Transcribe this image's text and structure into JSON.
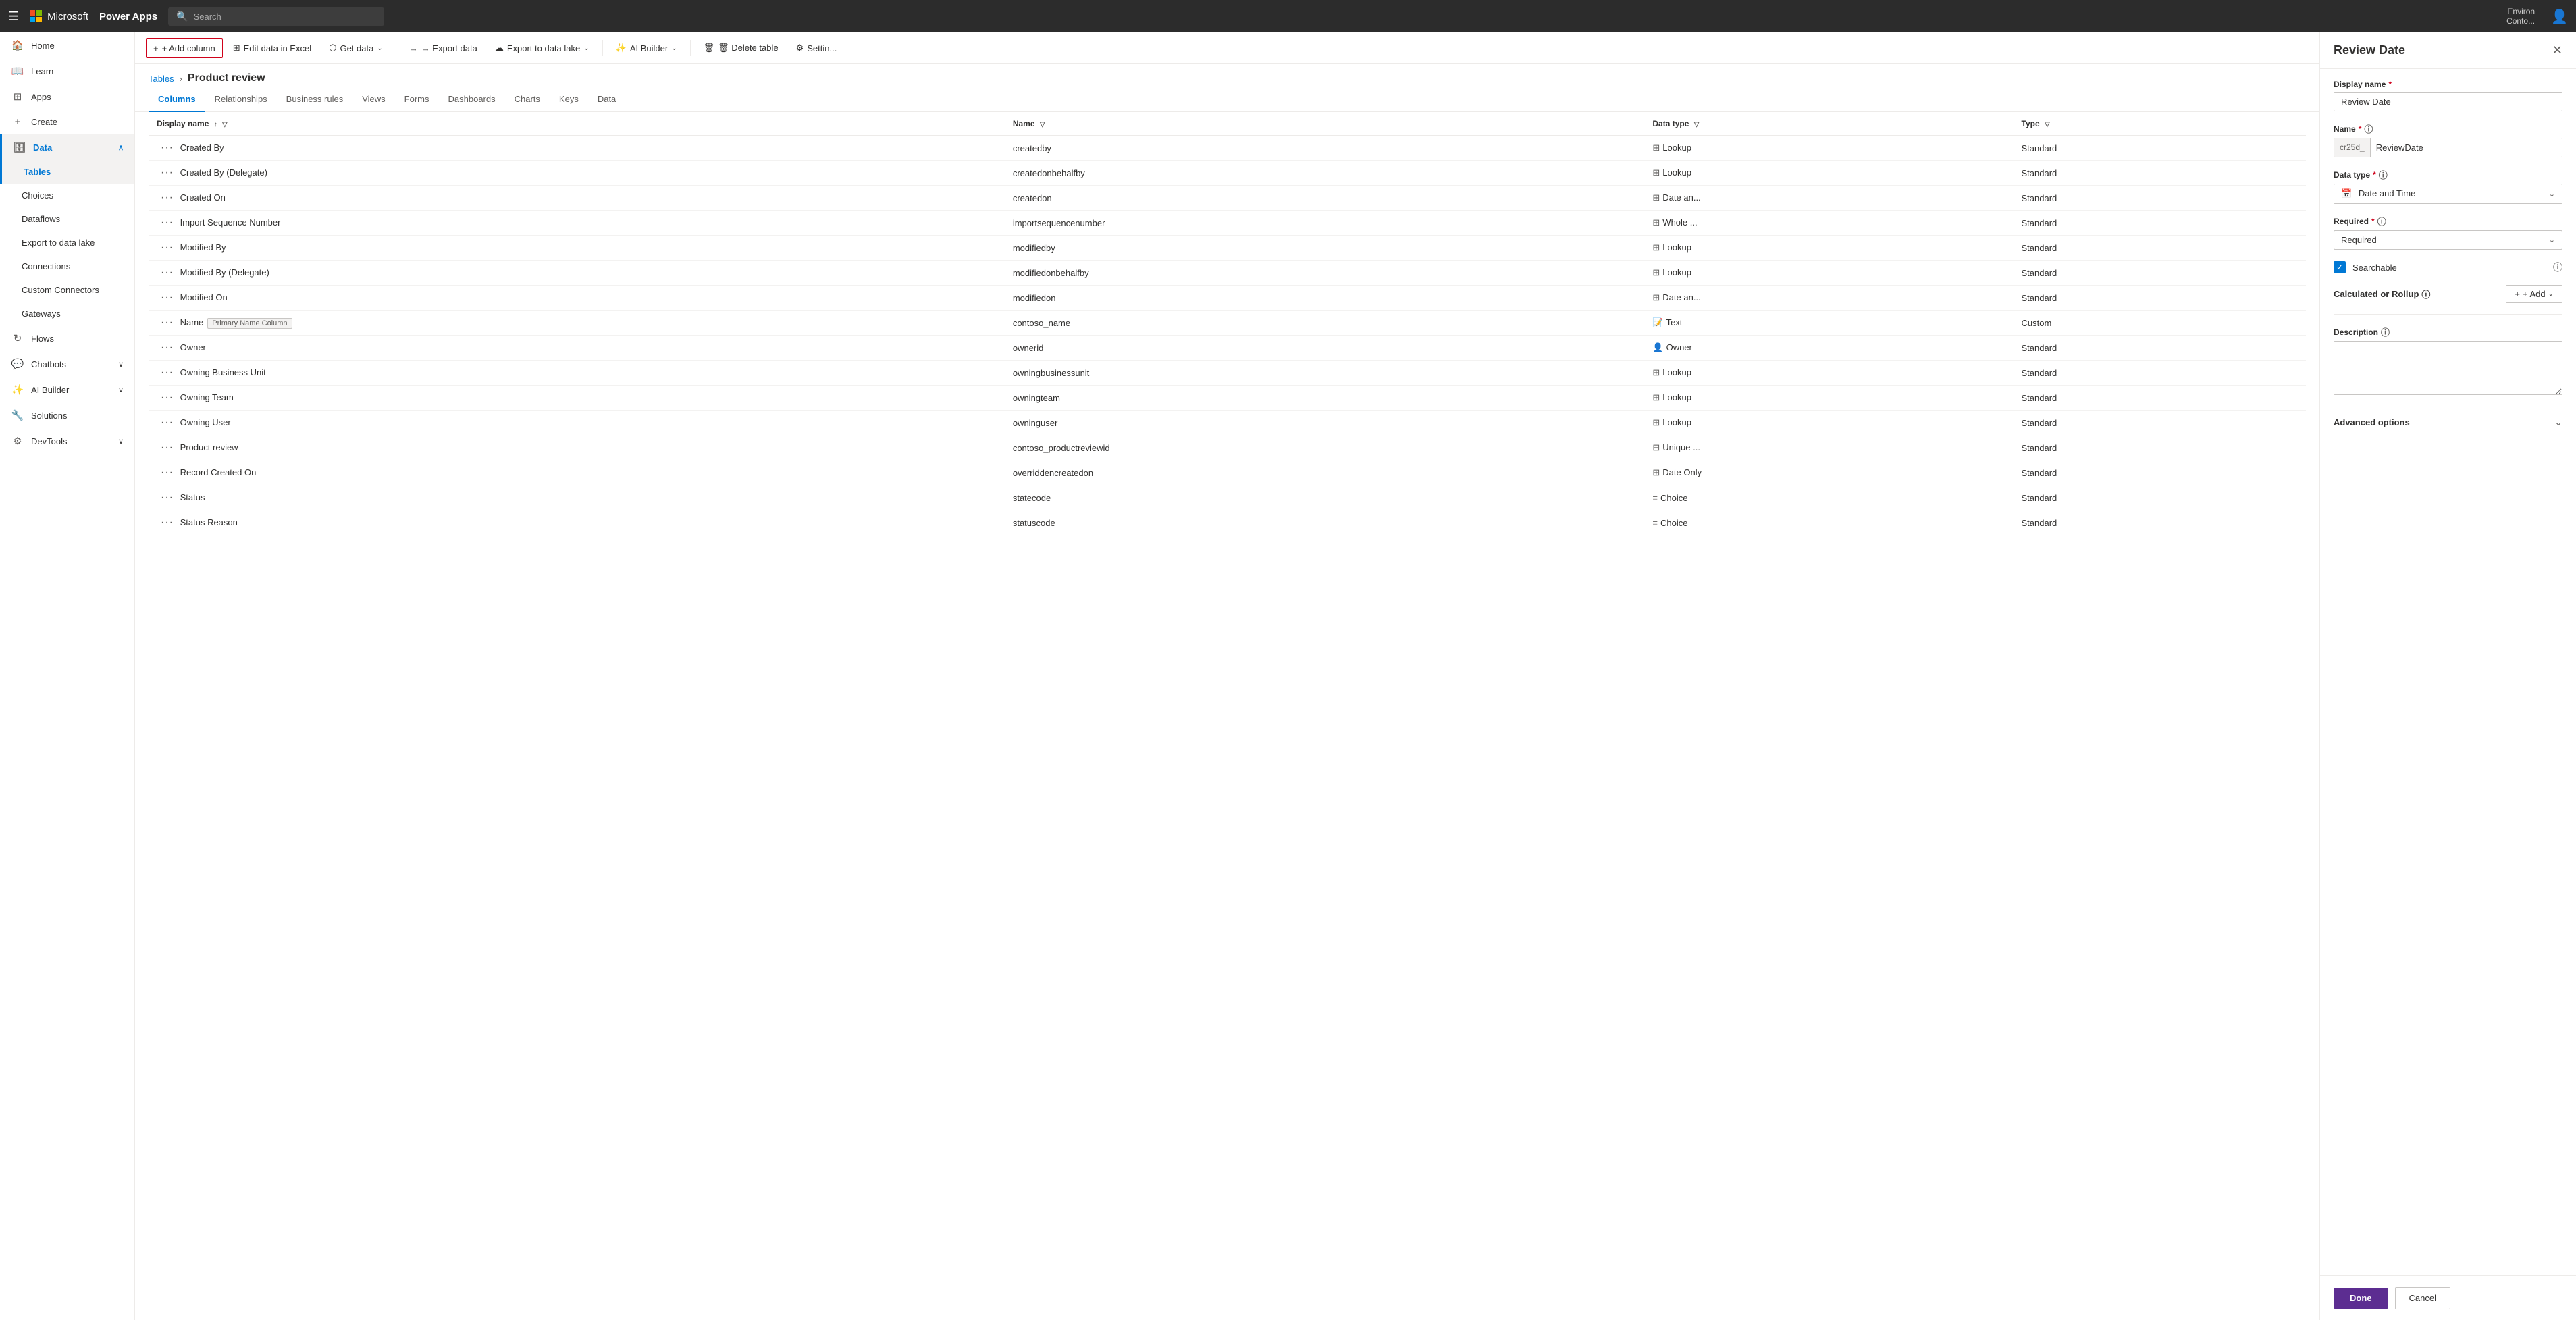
{
  "topNav": {
    "appName": "Power Apps",
    "searchPlaceholder": "Search",
    "env": "Environ",
    "user": "Conto..."
  },
  "sidebar": {
    "hamburgerIcon": "☰",
    "items": [
      {
        "id": "home",
        "label": "Home",
        "icon": "🏠",
        "active": false
      },
      {
        "id": "learn",
        "label": "Learn",
        "icon": "📖",
        "active": false
      },
      {
        "id": "apps",
        "label": "Apps",
        "icon": "⊞",
        "active": false
      },
      {
        "id": "create",
        "label": "Create",
        "icon": "+",
        "active": false
      },
      {
        "id": "data",
        "label": "Data",
        "icon": "🗄",
        "active": true,
        "expandable": true,
        "expanded": true
      },
      {
        "id": "tables",
        "label": "Tables",
        "sub": true,
        "active": true
      },
      {
        "id": "choices",
        "label": "Choices",
        "sub": true,
        "active": false
      },
      {
        "id": "dataflows",
        "label": "Dataflows",
        "sub": true,
        "active": false
      },
      {
        "id": "export-data-lake",
        "label": "Export to data lake",
        "sub": true,
        "active": false
      },
      {
        "id": "connections",
        "label": "Connections",
        "sub": true,
        "active": false
      },
      {
        "id": "custom-connectors",
        "label": "Custom Connectors",
        "sub": true,
        "active": false
      },
      {
        "id": "gateways",
        "label": "Gateways",
        "sub": true,
        "active": false
      },
      {
        "id": "flows",
        "label": "Flows",
        "icon": "↻",
        "active": false
      },
      {
        "id": "chatbots",
        "label": "Chatbots",
        "icon": "💬",
        "active": false,
        "expandable": true
      },
      {
        "id": "ai-builder",
        "label": "AI Builder",
        "icon": "✨",
        "active": false,
        "expandable": true
      },
      {
        "id": "solutions",
        "label": "Solutions",
        "icon": "🔧",
        "active": false
      },
      {
        "id": "devtools",
        "label": "DevTools",
        "icon": "⚙",
        "active": false,
        "expandable": true
      }
    ]
  },
  "toolbar": {
    "addColumnLabel": "+ Add column",
    "editExcelLabel": "Edit data in Excel",
    "getDataLabel": "Get data",
    "exportDataLabel": "→ Export data",
    "exportDataLakeLabel": "Export to data lake",
    "aiBuilderLabel": "AI Builder",
    "deleteTableLabel": "🗑 Delete table",
    "settingsLabel": "Settin..."
  },
  "breadcrumb": {
    "parent": "Tables",
    "current": "Product review"
  },
  "tabs": [
    {
      "id": "columns",
      "label": "Columns",
      "active": true
    },
    {
      "id": "relationships",
      "label": "Relationships",
      "active": false
    },
    {
      "id": "business-rules",
      "label": "Business rules",
      "active": false
    },
    {
      "id": "views",
      "label": "Views",
      "active": false
    },
    {
      "id": "forms",
      "label": "Forms",
      "active": false
    },
    {
      "id": "dashboards",
      "label": "Dashboards",
      "active": false
    },
    {
      "id": "charts",
      "label": "Charts",
      "active": false
    },
    {
      "id": "keys",
      "label": "Keys",
      "active": false
    },
    {
      "id": "data",
      "label": "Data",
      "active": false
    }
  ],
  "tableHeaders": [
    {
      "id": "display-name",
      "label": "Display name",
      "sortable": true,
      "sortDir": "asc"
    },
    {
      "id": "name",
      "label": "Name",
      "sortable": true
    },
    {
      "id": "data-type",
      "label": "Data type",
      "sortable": true
    },
    {
      "id": "type",
      "label": "Type",
      "sortable": true
    }
  ],
  "tableRows": [
    {
      "displayName": "Created By",
      "name": "createdby",
      "dataType": "Lookup",
      "typeIcon": "⊞",
      "type": "Standard"
    },
    {
      "displayName": "Created By (Delegate)",
      "name": "createdonbehalfby",
      "dataType": "Lookup",
      "typeIcon": "⊞",
      "type": "Standard"
    },
    {
      "displayName": "Created On",
      "name": "createdon",
      "dataType": "Date an...",
      "typeIcon": "⊞",
      "type": "Standard"
    },
    {
      "displayName": "Import Sequence Number",
      "name": "importsequencenumber",
      "dataType": "Whole ...",
      "typeIcon": "⊞",
      "type": "Standard"
    },
    {
      "displayName": "Modified By",
      "name": "modifiedby",
      "dataType": "Lookup",
      "typeIcon": "⊞",
      "type": "Standard"
    },
    {
      "displayName": "Modified By (Delegate)",
      "name": "modifiedonbehalfby",
      "dataType": "Lookup",
      "typeIcon": "⊞",
      "type": "Standard"
    },
    {
      "displayName": "Modified On",
      "name": "modifiedon",
      "dataType": "Date an...",
      "typeIcon": "⊞",
      "type": "Standard"
    },
    {
      "displayName": "Name",
      "name": "contoso_name",
      "badge": "Primary Name Column",
      "dataType": "Text",
      "typeIcon": "📝",
      "type": "Custom"
    },
    {
      "displayName": "Owner",
      "name": "ownerid",
      "dataType": "Owner",
      "typeIcon": "👤",
      "type": "Standard"
    },
    {
      "displayName": "Owning Business Unit",
      "name": "owningbusinessunit",
      "dataType": "Lookup",
      "typeIcon": "⊞",
      "type": "Standard"
    },
    {
      "displayName": "Owning Team",
      "name": "owningteam",
      "dataType": "Lookup",
      "typeIcon": "⊞",
      "type": "Standard"
    },
    {
      "displayName": "Owning User",
      "name": "owninguser",
      "dataType": "Lookup",
      "typeIcon": "⊞",
      "type": "Standard"
    },
    {
      "displayName": "Product review",
      "name": "contoso_productreviewid",
      "dataType": "Unique ...",
      "typeIcon": "⊟",
      "type": "Standard"
    },
    {
      "displayName": "Record Created On",
      "name": "overriddencreatedon",
      "dataType": "Date Only",
      "typeIcon": "⊞",
      "type": "Standard"
    },
    {
      "displayName": "Status",
      "name": "statecode",
      "dataType": "Choice",
      "typeIcon": "≡",
      "type": "Standard"
    },
    {
      "displayName": "Status Reason",
      "name": "statuscode",
      "dataType": "Choice",
      "typeIcon": "≡",
      "type": "Standard"
    }
  ],
  "panel": {
    "title": "Review Date",
    "closeIcon": "✕",
    "displayNameLabel": "Display name",
    "displayNameValue": "Review Date",
    "nameLabel": "Name",
    "namePrefix": "cr25d_",
    "nameValue": "ReviewDate",
    "dataTypeLabel": "Data type",
    "dataTypeValue": "Date and Time",
    "dataTypeIcon": "📅",
    "requiredLabel": "Required",
    "requiredValue": "Required",
    "searchableLabel": "Searchable",
    "searchableChecked": true,
    "calcOrRollupLabel": "Calculated or Rollup",
    "addLabel": "+ Add",
    "descriptionLabel": "Description",
    "descriptionValue": "",
    "advancedOptionsLabel": "Advanced options",
    "doneLabel": "Done",
    "cancelLabel": "Cancel"
  }
}
